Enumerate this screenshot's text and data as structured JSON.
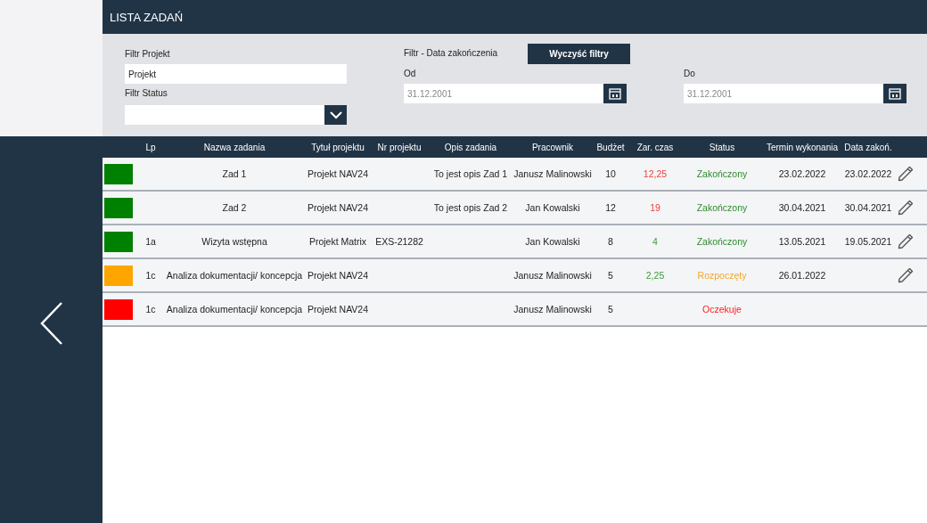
{
  "title": "LISTA ZADAŃ",
  "filters": {
    "project_label": "Filtr Projekt",
    "project_value": "Projekt",
    "status_label": "Filtr Status",
    "date_label": "Filtr - Data zakończenia",
    "clear_button": "Wyczyść filtry",
    "from_label": "Od",
    "from_value": "31.12.2001",
    "to_label": "Do",
    "to_value": "31.12.2001"
  },
  "table": {
    "columns": [
      "Lp",
      "Nazwa zadania",
      "Tytuł projektu",
      "Nr projektu",
      "Opis zadania",
      "Pracownik",
      "Budżet",
      "Zar. czas",
      "Status",
      "Termin wykonania",
      "Data zakoń."
    ],
    "rows": [
      {
        "color": "#008000",
        "name": "Zad 1",
        "project": "Projekt NAV24",
        "description": "To jest opis Zad 1",
        "employee": "Janusz Malinowski",
        "budget": "10",
        "time": {
          "text": "12,25",
          "kind": "over"
        },
        "status": {
          "text": "Zakończony",
          "kind": "done"
        },
        "due": "23.02.2022",
        "done": "23.02.2022",
        "editable": true
      },
      {
        "color": "#008000",
        "name": "Zad 2",
        "project": "Projekt NAV24",
        "description": "To jest opis Zad 2",
        "employee": "Jan Kowalski",
        "budget": "12",
        "time": {
          "text": "19",
          "kind": "over"
        },
        "status": {
          "text": "Zakończony",
          "kind": "done"
        },
        "due": "30.04.2021",
        "done": "30.04.2021",
        "editable": true
      },
      {
        "color": "#008000",
        "lp": "1a",
        "name": "Wizyta wstępna",
        "project": "Projekt Matrix",
        "number": "EXS-21282",
        "employee": "Jan Kowalski",
        "budget": "8",
        "time": {
          "text": "4",
          "kind": "ok"
        },
        "status": {
          "text": "Zakończony",
          "kind": "done"
        },
        "due": "13.05.2021",
        "done": "19.05.2021",
        "editable": true
      },
      {
        "color": "#ffa500",
        "lp": "1c",
        "name": "Analiza dokumentacji/ koncepcja",
        "project": "Projekt NAV24",
        "employee": "Janusz Malinowski",
        "budget": "5",
        "time": {
          "text": "2,25",
          "kind": "ok"
        },
        "status": {
          "text": "Rozpoczęty",
          "kind": "started"
        },
        "due": "26.01.2022",
        "editable": true
      },
      {
        "color": "#ff0000",
        "lp": "1c",
        "name": "Analiza dokumentacji/ koncepcja",
        "project": "Projekt NAV24",
        "employee": "Janusz Malinowski",
        "budget": "5",
        "status": {
          "text": "Oczekuje",
          "kind": "waiting"
        },
        "editable": false
      }
    ]
  }
}
